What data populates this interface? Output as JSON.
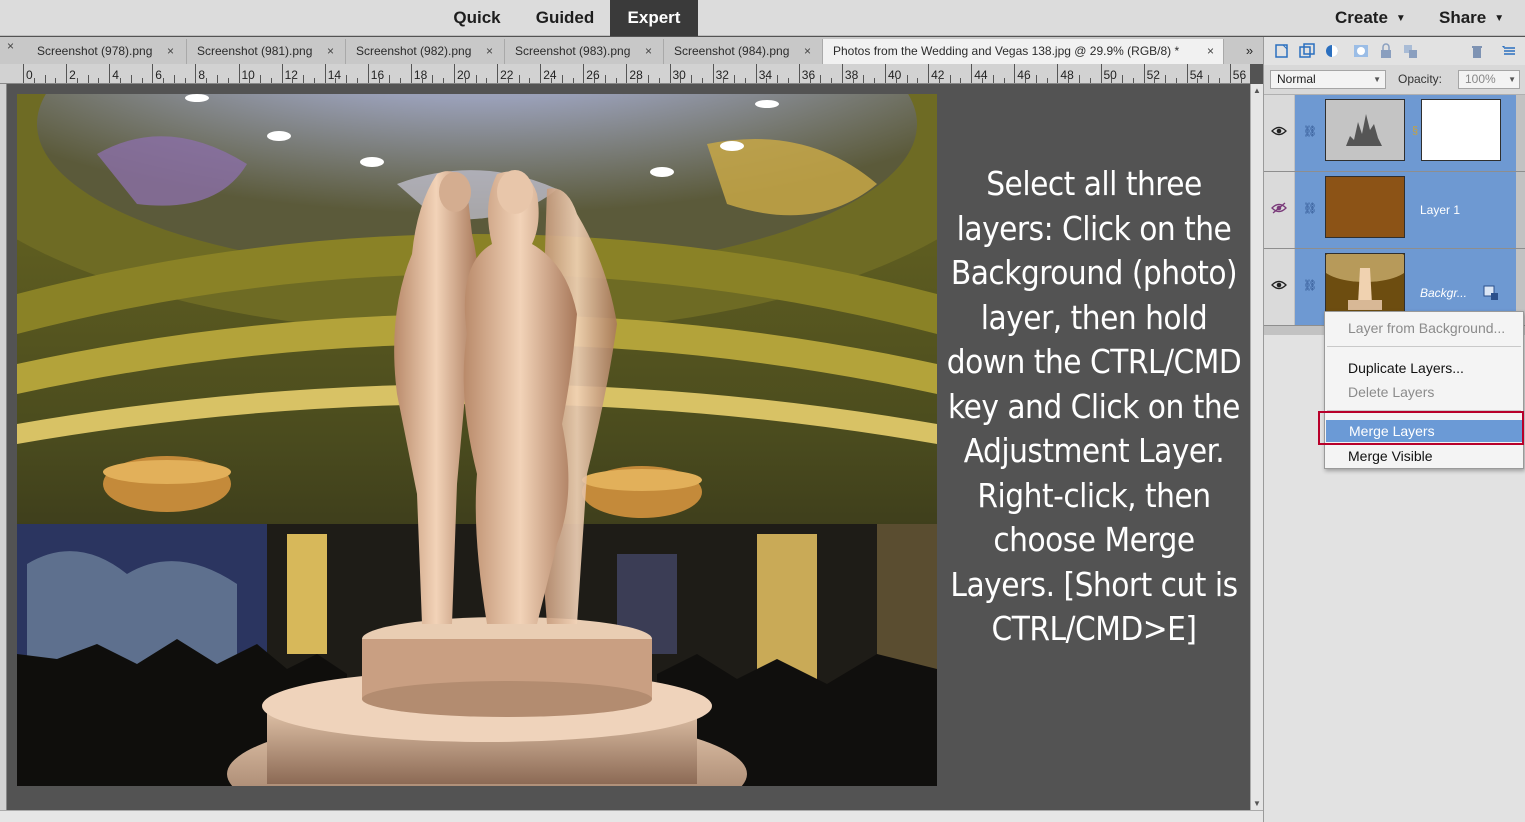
{
  "modes": [
    "Quick",
    "Guided",
    "Expert"
  ],
  "active_mode": "Expert",
  "header_menus": {
    "create": "Create",
    "share": "Share"
  },
  "tabs": [
    "Screenshot (978).png",
    "Screenshot (981).png",
    "Screenshot (982).png",
    "Screenshot (983).png",
    "Screenshot (984).png",
    "Photos from the Wedding and Vegas 138.jpg @ 29.9% (RGB/8) *"
  ],
  "tab_close": "×",
  "tabs_more": "»",
  "ruler_numbers": [
    "0",
    "2",
    "4",
    "6",
    "8",
    "10",
    "12",
    "14",
    "16",
    "18",
    "20",
    "22",
    "24",
    "26",
    "28",
    "30",
    "32",
    "34",
    "36",
    "38",
    "40",
    "42",
    "44",
    "46",
    "48",
    "50",
    "52",
    "54",
    "56"
  ],
  "instruction": "Select all three layers: Click on the Background (photo) layer, then hold down the CTRL/CMD key and Click on the Adjustment Layer. Right-click, then choose Merge Layers. [Short cut is CTRL/CMD>E]",
  "layer_options": {
    "blend_mode": "Normal",
    "opacity_label": "Opacity:",
    "opacity_value": "100%"
  },
  "layers": [
    {
      "name": "",
      "visible": true,
      "type": "adjustment"
    },
    {
      "name": "Layer 1",
      "visible": false,
      "type": "fill",
      "color": "#8c5316"
    },
    {
      "name": "Backgr...",
      "visible": true,
      "type": "photo"
    }
  ],
  "context_menu": {
    "items": [
      {
        "label": "Layer from Background...",
        "enabled": false
      },
      {
        "label": "Duplicate Layers...",
        "enabled": true
      },
      {
        "label": "Delete Layers",
        "enabled": false
      },
      {
        "label": "Merge Layers",
        "enabled": true,
        "highlighted": true
      },
      {
        "label": "Merge Visible",
        "enabled": true
      }
    ]
  },
  "colors": {
    "accent": "#6b9ad6",
    "highlight_box": "#b8002a",
    "layer_selected": "#6e99d2"
  }
}
